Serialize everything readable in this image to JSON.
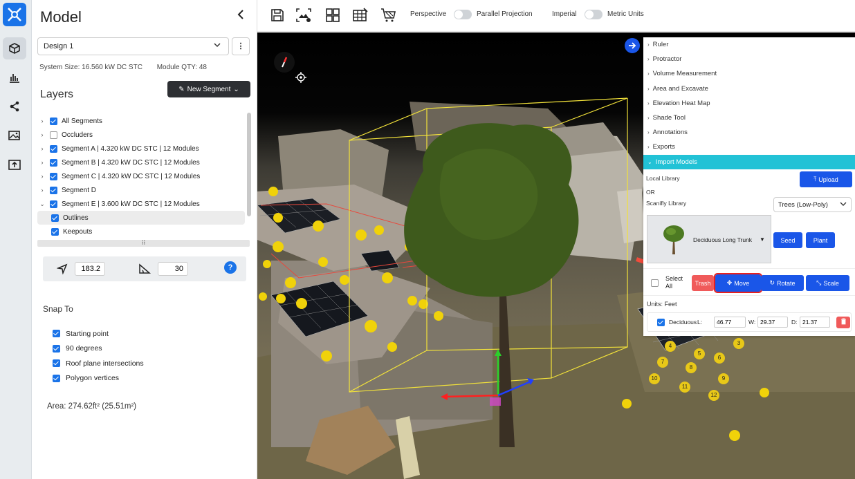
{
  "sidebar": {
    "title": "Model",
    "design_select": "Design 1",
    "system_size": "System Size: 16.560 kW DC STC",
    "module_qty": "Module QTY: 48",
    "layers_title": "Layers",
    "new_segment": "New Segment",
    "layers": [
      {
        "label": "All Segments",
        "checked": true
      },
      {
        "label": "Occluders",
        "checked": false
      },
      {
        "label": "Segment A | 4.320 kW DC STC | 12 Modules",
        "checked": true
      },
      {
        "label": "Segment B | 4.320 kW DC STC | 12 Modules",
        "checked": true
      },
      {
        "label": "Segment C | 4.320 kW DC STC | 12 Modules",
        "checked": true
      },
      {
        "label": "Segment D",
        "checked": true
      },
      {
        "label": "Segment E | 3.600 kW DC STC | 12 Modules",
        "checked": true
      },
      {
        "label": "Outlines",
        "checked": true
      },
      {
        "label": "Keepouts",
        "checked": true
      }
    ],
    "azimuth": "183.2",
    "pitch": "30",
    "help": "?",
    "snap_title": "Snap To",
    "snap_options": [
      "Starting point",
      "90 degrees",
      "Roof plane intersections",
      "Polygon vertices"
    ],
    "area": "Area: 274.62ft²  (25.51m²)"
  },
  "toolbar": {
    "perspective": "Perspective",
    "parallel": "Parallel Projection",
    "imperial": "Imperial",
    "metric": "Metric Units"
  },
  "tools": {
    "items": [
      "Ruler",
      "Protractor",
      "Volume Measurement",
      "Area and Excavate",
      "Elevation Heat Map",
      "Shade Tool",
      "Annotations",
      "Exports",
      "Import Models"
    ],
    "local_library": "Local Library",
    "or": "OR",
    "scanifly_library": "Scanifly Library",
    "upload": "Upload",
    "library_select": "Trees (Low-Poly)",
    "model_name": "Deciduous Long Trunk",
    "seed": "Seed",
    "plant": "Plant",
    "select_all": "Select All",
    "trash": "Trash",
    "move": "Move",
    "rotate": "Rotate",
    "scale": "Scale",
    "units": "Units: Feet",
    "row_name": "Deciduous Lo...",
    "l_label": "L:",
    "l_value": "46.77",
    "w_label": "W:",
    "w_value": "29.37",
    "d_label": "D:",
    "d_value": "21.37"
  },
  "scene": {
    "panel_numbers": [
      "4",
      "5",
      "3",
      "7",
      "8",
      "6",
      "10",
      "11",
      "12",
      "9"
    ]
  },
  "colors": {
    "accent": "#1a56e8",
    "active_tool": "#22c2d6",
    "trash": "#f05a5a",
    "highlight": "#e62020"
  }
}
